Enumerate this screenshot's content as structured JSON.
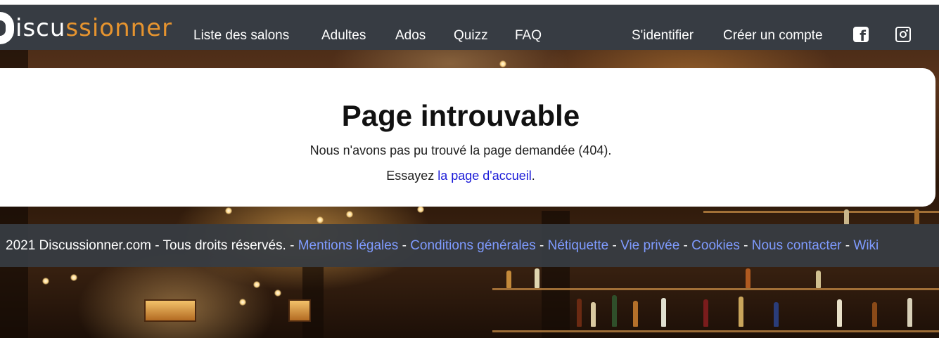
{
  "logo": {
    "part_white": "iscu",
    "part_orange": "ssionner"
  },
  "nav": {
    "links": [
      "Liste des salons",
      "Adultes",
      "Ados",
      "Quizz",
      "FAQ"
    ],
    "login": "S'identifier",
    "signup": "Créer un compte",
    "facebook_icon": "facebook-icon",
    "instagram_icon": "instagram-icon"
  },
  "error": {
    "title": "Page introuvable",
    "message": "Nous n'avons pas pu trouvé la page demandée (404).",
    "try_prefix": "Essayez ",
    "home_link": "la page d'accueil",
    "try_suffix": "."
  },
  "footer": {
    "copyright": "2021 Discussionner.com - Tous droits réservés.",
    "separator": " - ",
    "links": [
      "Mentions légales",
      "Conditions générales",
      "Nétiquette",
      "Vie privée",
      "Cookies",
      "Nous contacter",
      "Wiki"
    ]
  },
  "colors": {
    "navbar": "#373c43",
    "logo_accent": "#e6942f",
    "link_card": "#1a1ad8",
    "link_footer": "#7f9bff"
  }
}
